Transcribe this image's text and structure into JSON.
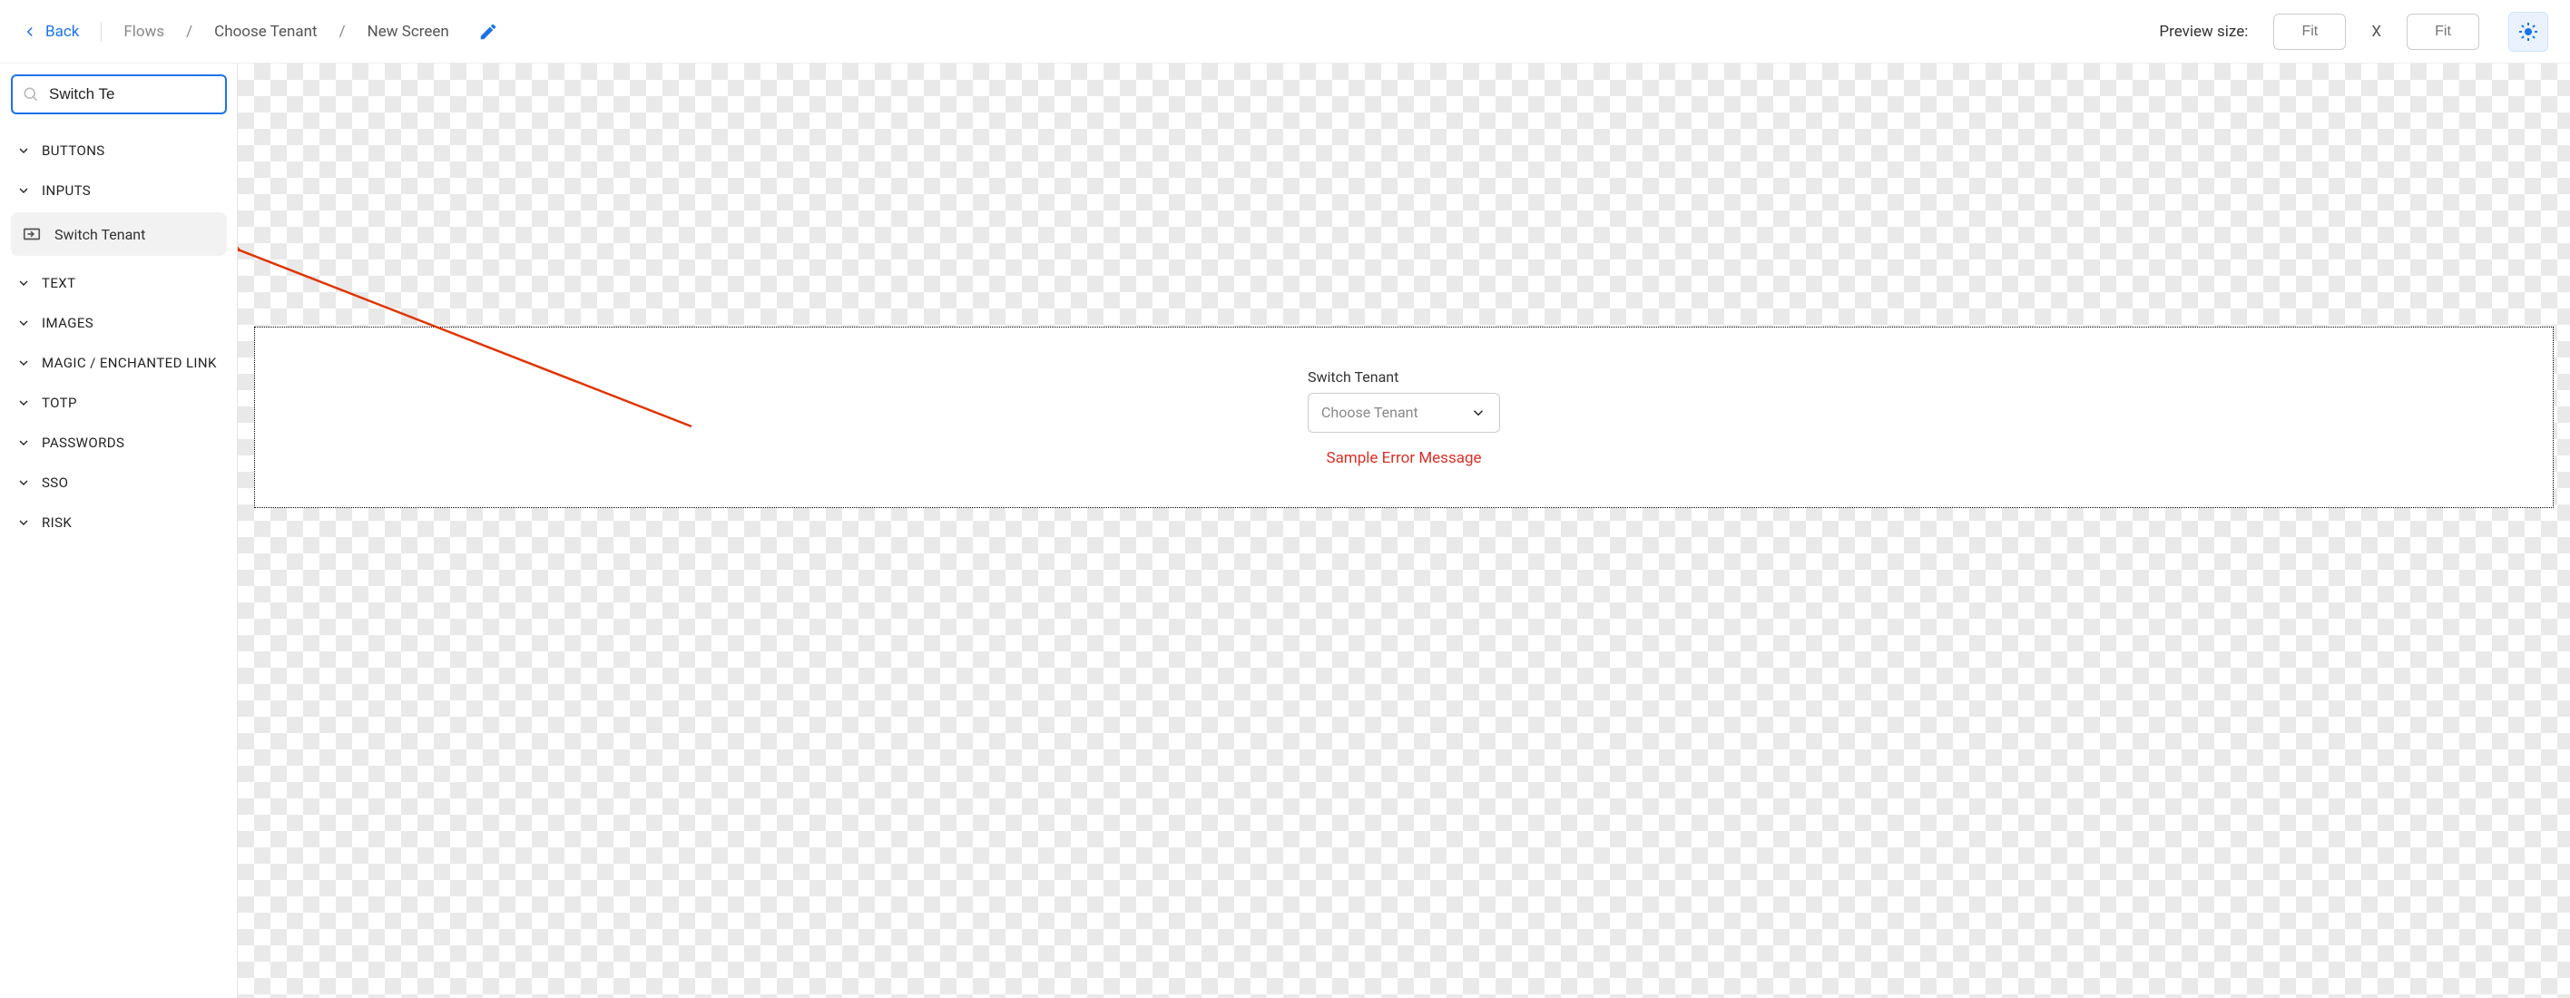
{
  "header": {
    "back_label": "Back",
    "breadcrumb": [
      "Flows",
      "Choose Tenant",
      "New Screen"
    ],
    "preview_label": "Preview size:",
    "preview_x": "X",
    "fit_placeholder": "Fit"
  },
  "sidebar": {
    "search_value": "Switch Te",
    "search_placeholder": "",
    "categories": [
      "Buttons",
      "Inputs",
      "Text",
      "Images",
      "Magic / Enchanted Link",
      "TOTP",
      "Passwords",
      "SSO",
      "Risk"
    ],
    "component_label": "Switch Tenant"
  },
  "canvas": {
    "field_label": "Switch Tenant",
    "select_placeholder": "Choose Tenant",
    "error_message": "Sample Error Message"
  },
  "colors": {
    "accent": "#1a73e8",
    "error": "#d93025"
  }
}
